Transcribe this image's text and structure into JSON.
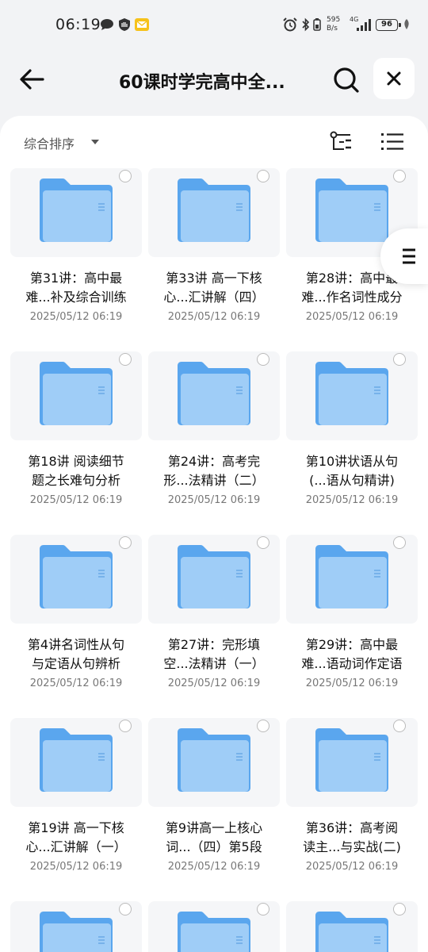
{
  "status": {
    "time": "06:19",
    "net_speed_top": "595",
    "net_speed_bottom": "B/s",
    "signal_label": "4G",
    "battery": "96"
  },
  "header": {
    "title": "60课时学完高中全..."
  },
  "sort": {
    "label": "综合排序"
  },
  "colors": {
    "folder_back": "#5aa6ee",
    "folder_front": "#9fcdf7",
    "tile_bg": "#f5f6f8"
  },
  "files": [
    {
      "line1": "第31讲：高中最",
      "line2": "难...补及综合训练",
      "date": "2025/05/12 06:19"
    },
    {
      "line1": "第33讲 高一下核",
      "line2": "心...汇讲解（四）",
      "date": "2025/05/12 06:19"
    },
    {
      "line1": "第28讲：高中最",
      "line2": "难...作名词性成分",
      "date": "2025/05/12 06:19"
    },
    {
      "line1": "第18讲 阅读细节",
      "line2": "题之长难句分析",
      "date": "2025/05/12 06:19"
    },
    {
      "line1": "第24讲：高考完",
      "line2": "形...法精讲（二）",
      "date": "2025/05/12 06:19"
    },
    {
      "line1": "第10讲状语从句",
      "line2": "(...语从句精讲)",
      "date": "2025/05/12 06:19"
    },
    {
      "line1": "第4讲名词性从句",
      "line2": "与定语从句辨析",
      "date": "2025/05/12 06:19"
    },
    {
      "line1": "第27讲：完形填",
      "line2": "空...法精讲（一）",
      "date": "2025/05/12 06:19"
    },
    {
      "line1": "第29讲：高中最",
      "line2": "难...语动词作定语",
      "date": "2025/05/12 06:19"
    },
    {
      "line1": "第19讲 高一下核",
      "line2": "心...汇讲解（一）",
      "date": "2025/05/12 06:19"
    },
    {
      "line1": "第9讲高一上核心",
      "line2": "词...（四）第5段",
      "date": "2025/05/12 06:19"
    },
    {
      "line1": "第36讲：高考阅",
      "line2": "读主...与实战(二)",
      "date": "2025/05/12 06:19"
    }
  ]
}
